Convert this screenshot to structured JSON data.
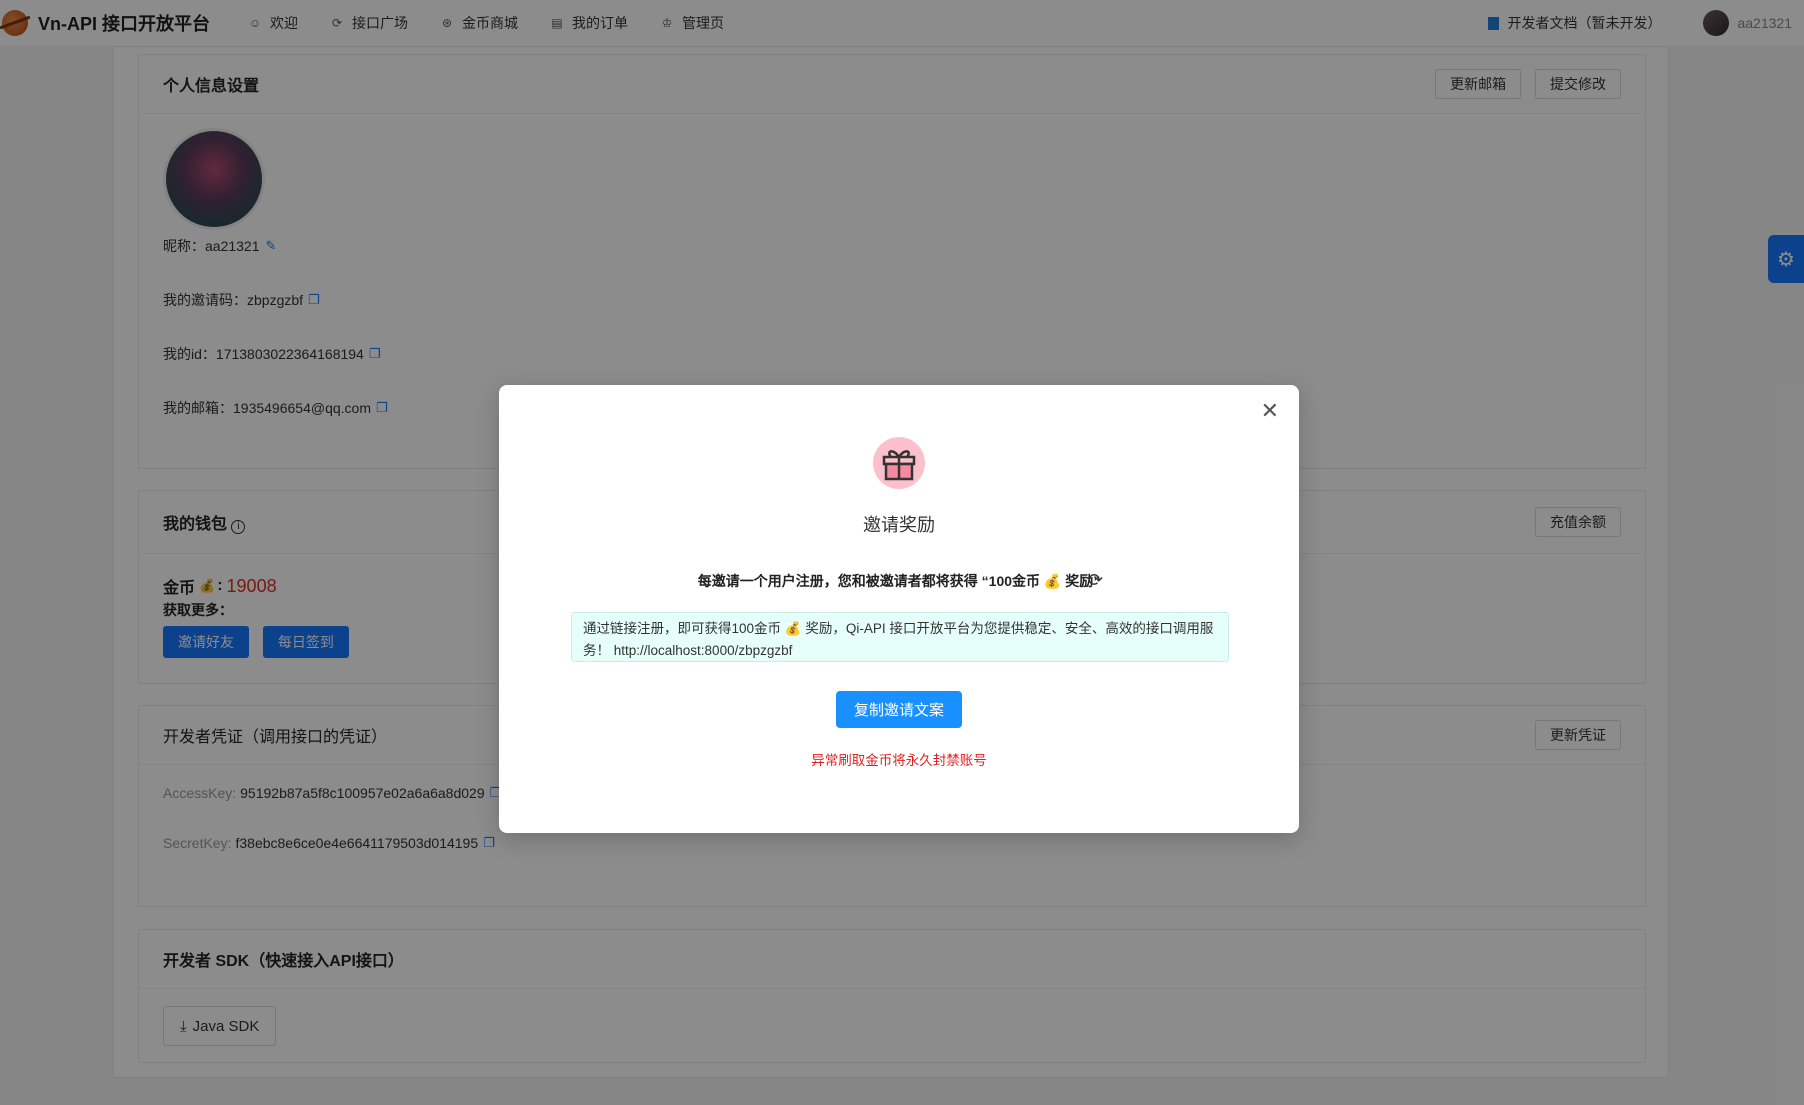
{
  "header": {
    "brand": "Vn-API 接口开放平台",
    "nav": [
      {
        "label": "欢迎",
        "icon": "smile-icon"
      },
      {
        "label": "接口广场",
        "icon": "api-icon"
      },
      {
        "label": "金币商城",
        "icon": "coin-icon"
      },
      {
        "label": "我的订单",
        "icon": "order-icon"
      },
      {
        "label": "管理页",
        "icon": "crown-icon"
      }
    ],
    "doc_link": "开发者文档（暂未开发）",
    "username": "aa21321"
  },
  "profile": {
    "title": "个人信息设置",
    "btn_update_email": "更新邮箱",
    "btn_submit": "提交修改",
    "nickname_label": "昵称：",
    "nickname": "aa21321",
    "invite_code_label": "我的邀请码：",
    "invite_code": "zbpzgzbf",
    "id_label": "我的id：",
    "id": "1713803022364168194",
    "email_label": "我的邮箱：",
    "email": "1935496654@qq.com"
  },
  "wallet": {
    "title": "我的钱包",
    "btn_recharge": "充值余额",
    "coin_label": "金币",
    "coin_value": "19008",
    "more_label": "获取更多：",
    "btn_invite": "邀请好友",
    "btn_signin": "每日签到"
  },
  "credentials": {
    "title": "开发者凭证（调用接口的凭证）",
    "btn_update": "更新凭证",
    "access_label": "AccessKey:",
    "access_key": "95192b87a5f8c100957e02a6a6a8d029",
    "secret_label": "SecretKey:",
    "secret_key": "f38ebc8e6ce0e4e6641179503d014195"
  },
  "sdk": {
    "title": "开发者 SDK（快速接入API接口）",
    "btn_java": "Java SDK"
  },
  "modal": {
    "title": "邀请奖励",
    "tip": "每邀请一个用户注册，您和被邀请者都将获得 “100金币 💰 奖励”",
    "invite_text": "通过链接注册，即可获得100金币 💰 奖励，Qi-API 接口开放平台为您提供稳定、安全、高效的接口调用服务！ http://localhost:8000/zbpzgzbf",
    "copy_button": "复制邀请文案",
    "warning": "异常刷取金币将永久封禁账号"
  }
}
